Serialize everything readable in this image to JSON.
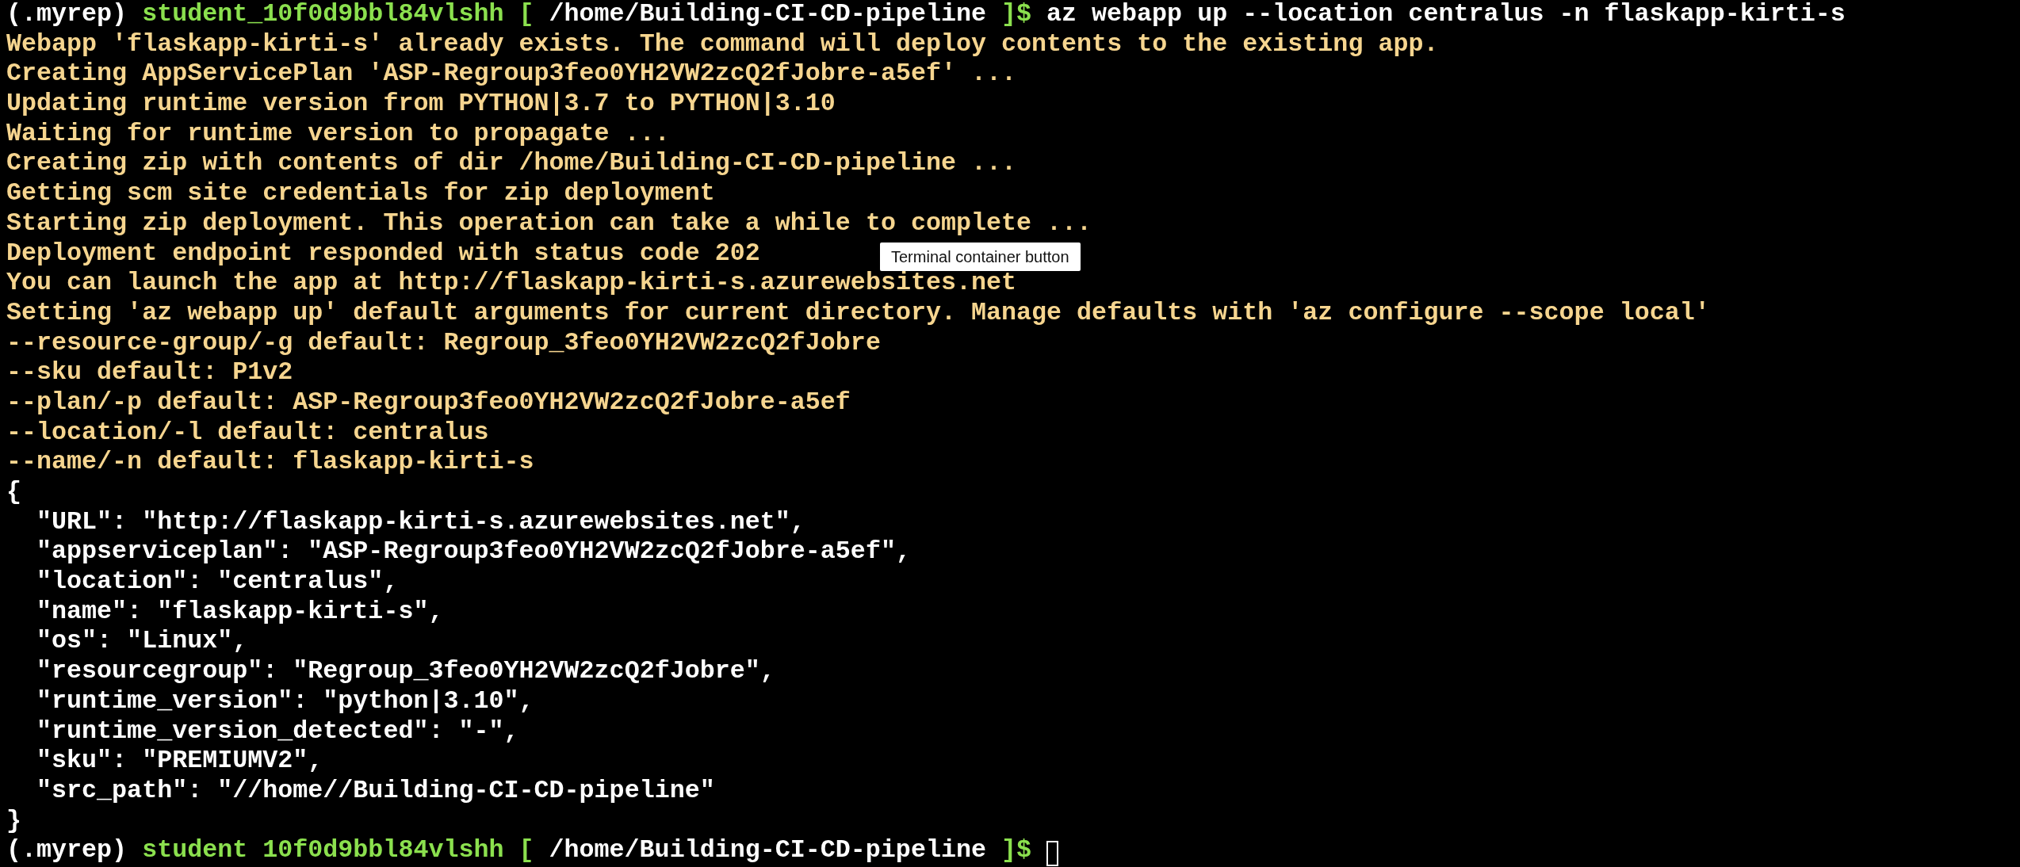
{
  "lines": [
    {
      "kind": "prompt",
      "env": "(.myrep)",
      "user": "student_10f0d9bbl84vlshh",
      "open": "[",
      "path": "/home/Building-CI-CD-pipeline",
      "close": "]$",
      "command": "az webapp up --location centralus -n flaskapp-kirti-s",
      "cursor": false
    },
    {
      "kind": "output",
      "text": "Webapp 'flaskapp-kirti-s' already exists. The command will deploy contents to the existing app."
    },
    {
      "kind": "output",
      "text": "Creating AppServicePlan 'ASP-Regroup3feo0YH2VW2zcQ2fJobre-a5ef' ..."
    },
    {
      "kind": "output",
      "text": "Updating runtime version from PYTHON|3.7 to PYTHON|3.10"
    },
    {
      "kind": "output",
      "text": "Waiting for runtime version to propagate ..."
    },
    {
      "kind": "output",
      "text": "Creating zip with contents of dir /home/Building-CI-CD-pipeline ..."
    },
    {
      "kind": "output",
      "text": "Getting scm site credentials for zip deployment"
    },
    {
      "kind": "output",
      "text": "Starting zip deployment. This operation can take a while to complete ..."
    },
    {
      "kind": "output",
      "text": "Deployment endpoint responded with status code 202"
    },
    {
      "kind": "output",
      "text": "You can launch the app at http://flaskapp-kirti-s.azurewebsites.net"
    },
    {
      "kind": "output",
      "text": "Setting 'az webapp up' default arguments for current directory. Manage defaults with 'az configure --scope local'"
    },
    {
      "kind": "output",
      "text": "--resource-group/-g default: Regroup_3feo0YH2VW2zcQ2fJobre"
    },
    {
      "kind": "output",
      "text": "--sku default: P1v2"
    },
    {
      "kind": "output",
      "text": "--plan/-p default: ASP-Regroup3feo0YH2VW2zcQ2fJobre-a5ef"
    },
    {
      "kind": "output",
      "text": "--location/-l default: centralus"
    },
    {
      "kind": "output",
      "text": "--name/-n default: flaskapp-kirti-s"
    },
    {
      "kind": "json",
      "text": "{"
    },
    {
      "kind": "json",
      "text": "  \"URL\": \"http://flaskapp-kirti-s.azurewebsites.net\","
    },
    {
      "kind": "json",
      "text": "  \"appserviceplan\": \"ASP-Regroup3feo0YH2VW2zcQ2fJobre-a5ef\","
    },
    {
      "kind": "json",
      "text": "  \"location\": \"centralus\","
    },
    {
      "kind": "json",
      "text": "  \"name\": \"flaskapp-kirti-s\","
    },
    {
      "kind": "json",
      "text": "  \"os\": \"Linux\","
    },
    {
      "kind": "json",
      "text": "  \"resourcegroup\": \"Regroup_3feo0YH2VW2zcQ2fJobre\","
    },
    {
      "kind": "json",
      "text": "  \"runtime_version\": \"python|3.10\","
    },
    {
      "kind": "json",
      "text": "  \"runtime_version_detected\": \"-\","
    },
    {
      "kind": "json",
      "text": "  \"sku\": \"PREMIUMV2\","
    },
    {
      "kind": "json",
      "text": "  \"src_path\": \"//home//Building-CI-CD-pipeline\""
    },
    {
      "kind": "json",
      "text": "}"
    },
    {
      "kind": "prompt",
      "env": "(.myrep)",
      "user": "student 10f0d9bbl84vlshh",
      "open": "[",
      "path": "/home/Building-CI-CD-pipeline",
      "close": "]$",
      "cursor": true
    }
  ],
  "tooltip": {
    "text": "Terminal container button"
  }
}
